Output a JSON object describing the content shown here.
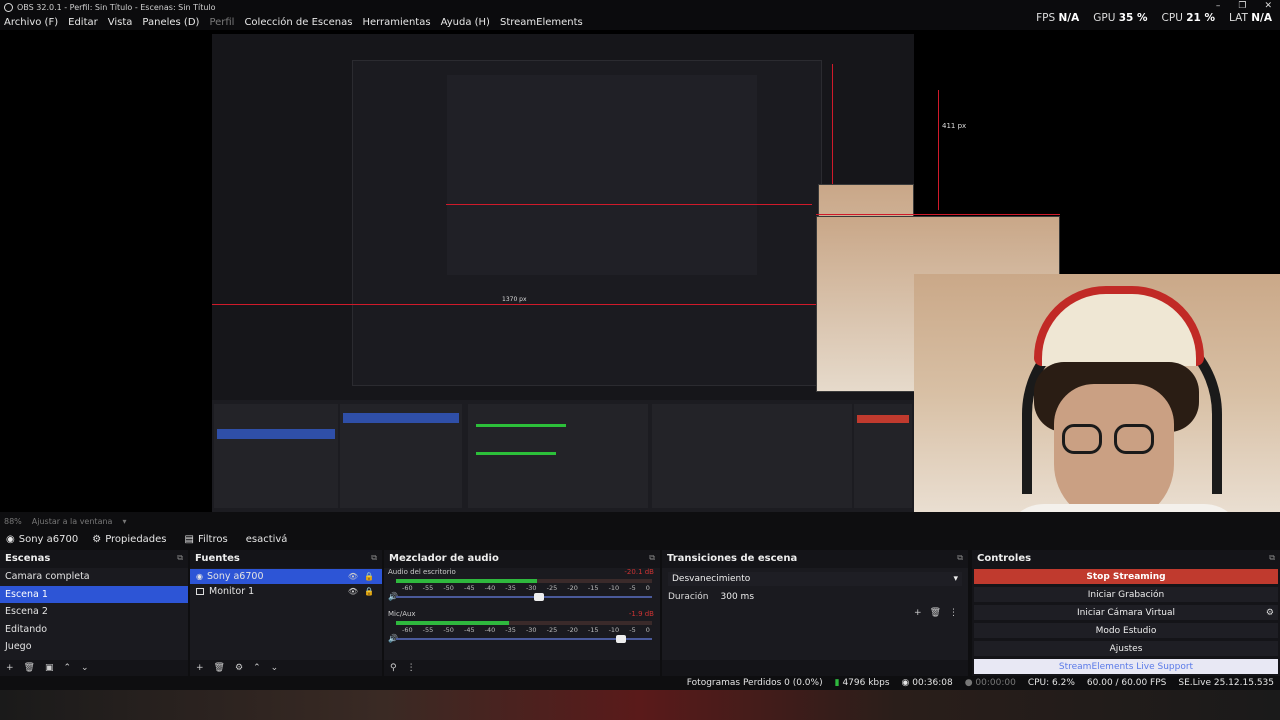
{
  "window": {
    "title": "OBS 32.0.1 - Perfil: Sin Título - Escenas: Sin Título"
  },
  "menu": {
    "items": [
      "Archivo (F)",
      "Editar",
      "Vista",
      "Paneles (D)",
      "Perfil",
      "Colección de Escenas",
      "Herramientas",
      "Ayuda (H)",
      "StreamElements"
    ]
  },
  "stats": {
    "fps_label": "FPS",
    "fps_value": "N/A",
    "gpu_label": "GPU",
    "gpu_value": "35 %",
    "cpu_label": "CPU",
    "cpu_value": "21 %",
    "lat_label": "LAT",
    "lat_value": "N/A"
  },
  "preview": {
    "nested_label_1": "1370 px",
    "nested_label_2": "411 px"
  },
  "scalebar": {
    "zoom": "88%",
    "fit": "Ajustar a la ventana"
  },
  "source_toolbar": {
    "source_name": "Sony a6700",
    "properties": "Propiedades",
    "filters": "Filtros",
    "deactivate": "esactivá"
  },
  "scenes": {
    "title": "Escenas",
    "items": [
      "Camara completa",
      "Escena 1",
      "Escena 2",
      "Editando",
      "Juego"
    ],
    "selected_index": 1
  },
  "sources": {
    "title": "Fuentes",
    "items": [
      "Sony a6700",
      "Monitor 1"
    ]
  },
  "mixer": {
    "title": "Mezclador de audio",
    "tracks": [
      {
        "name": "Audio del escritorio",
        "db": "-20.1 dB",
        "level": 0.55,
        "fader": 0.56
      },
      {
        "name": "Mic/Aux",
        "db": "-1.9 dB",
        "level": 0.44,
        "fader": 0.88
      }
    ],
    "ticks": [
      "-60",
      "-55",
      "-50",
      "-45",
      "-40",
      "-35",
      "-30",
      "-25",
      "-20",
      "-15",
      "-10",
      "-5",
      "0"
    ]
  },
  "transitions": {
    "title": "Transiciones de escena",
    "selected": "Desvanecimiento",
    "duration_label": "Duración",
    "duration_value": "300 ms"
  },
  "controls": {
    "title": "Controles",
    "buttons": [
      "Stop Streaming",
      "Iniciar Grabación",
      "Iniciar Cámara Virtual",
      "Modo Estudio",
      "Ajustes",
      "StreamElements Live Support"
    ]
  },
  "statusbar": {
    "dropped": "Fotogramas Perdidos 0 (0.0%)",
    "kbps": "4796 kbps",
    "stream_time": "00:36:08",
    "rec_time": "00:00:00",
    "cpu": "CPU: 6.2%",
    "fps": "60.00 / 60.00 FPS",
    "version": "SE.Live 25.12.15.535"
  },
  "colors": {
    "accent_selected": "#2d55d6",
    "stop_button": "#c03a2e",
    "meter_green": "#2fb83e"
  }
}
